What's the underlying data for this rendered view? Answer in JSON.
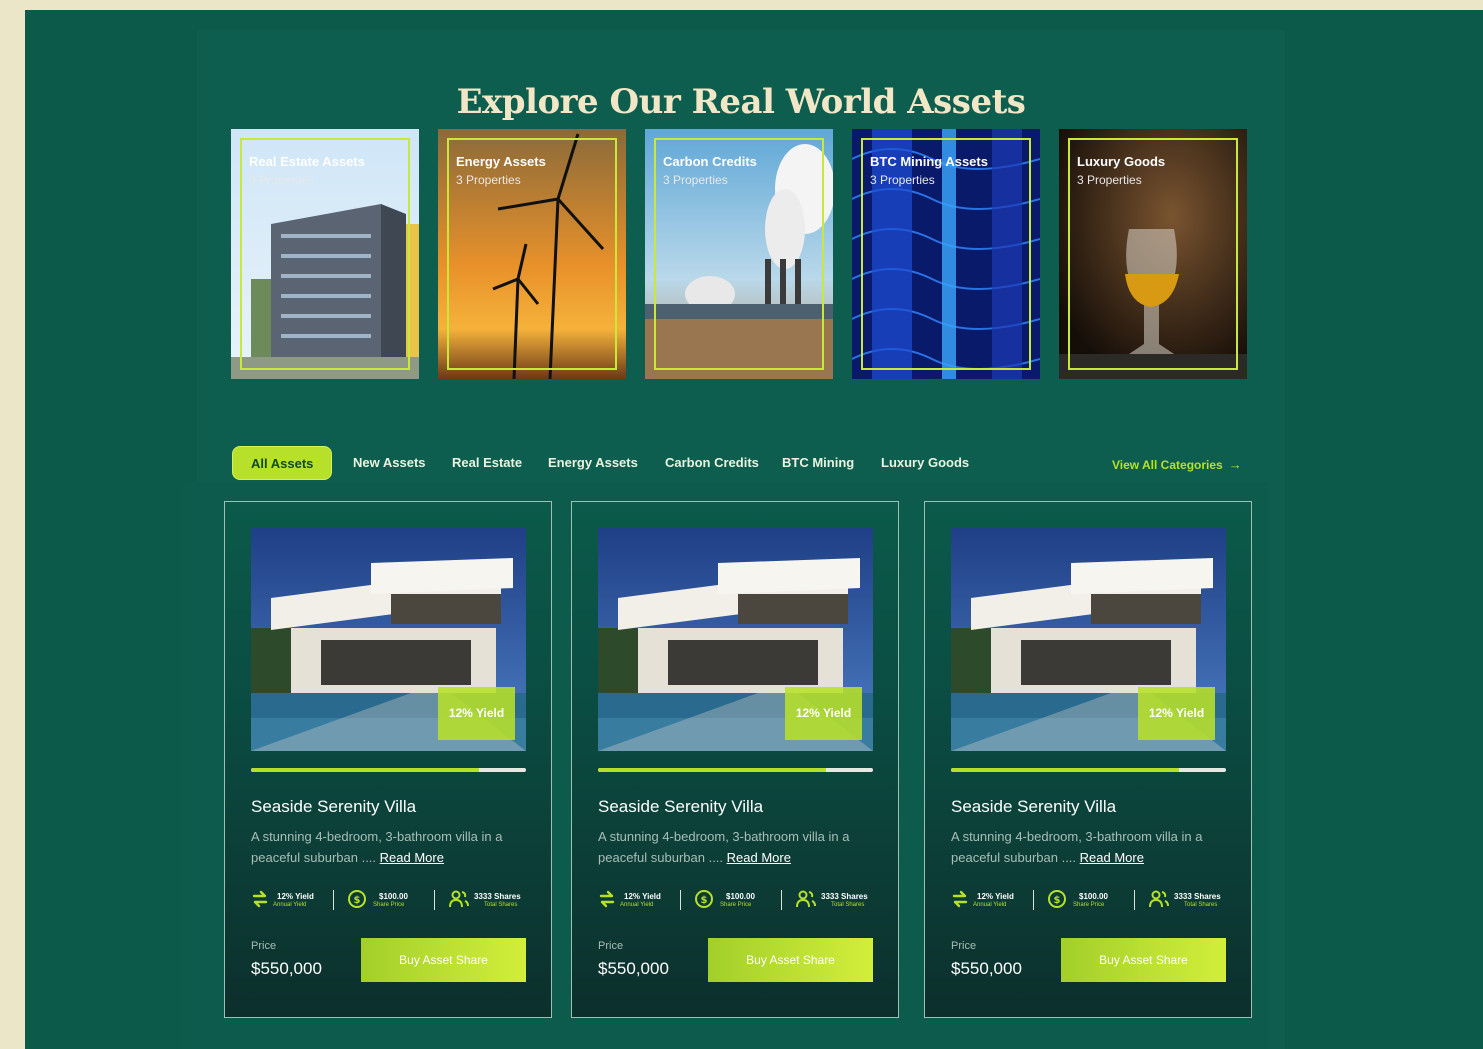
{
  "header": {
    "title": "Explore Our Real World Assets"
  },
  "categories": [
    {
      "name": "Real Estate Assets",
      "count": "3 Properties"
    },
    {
      "name": "Energy Assets",
      "count": "3 Properties"
    },
    {
      "name": "Carbon Credits",
      "count": "3 Properties"
    },
    {
      "name": "BTC Mining Assets",
      "count": "3 Properties"
    },
    {
      "name": "Luxury Goods",
      "count": "3 Properties"
    }
  ],
  "tabs": [
    "All Assets",
    "New Assets",
    "Real Estate",
    "Energy Assets",
    "Carbon Credits",
    "BTC Mining",
    "Luxury Goods"
  ],
  "active_tab": "All Assets",
  "view_all": {
    "label": "View All Categories",
    "icon": "arrow-right-icon"
  },
  "cards": [
    {
      "badge": "12% Yield",
      "progress": 0.83,
      "title": "Seaside Serenity Villa",
      "description": "A stunning 4-bedroom, 3-bathroom villa in a peaceful suburban ....",
      "read_more": "Read More",
      "stats": [
        {
          "icon": "swap-arrows-icon",
          "value": "12% Yield",
          "label": "Annual Yield"
        },
        {
          "icon": "dollar-coin-icon",
          "value": "$100.00",
          "label": "Share Price"
        },
        {
          "icon": "users-icon",
          "value": "3333 Shares",
          "label": "Total Shares"
        }
      ],
      "price_label": "Price",
      "price": "$550,000",
      "button": "Buy Asset Share"
    },
    {
      "badge": "12% Yield",
      "progress": 0.83,
      "title": "Seaside Serenity Villa",
      "description": "A stunning 4-bedroom, 3-bathroom villa in a peaceful suburban ....",
      "read_more": "Read More",
      "stats": [
        {
          "icon": "swap-arrows-icon",
          "value": "12% Yield",
          "label": "Annual Yield"
        },
        {
          "icon": "dollar-coin-icon",
          "value": "$100.00",
          "label": "Share Price"
        },
        {
          "icon": "users-icon",
          "value": "3333 Shares",
          "label": "Total Shares"
        }
      ],
      "price_label": "Price",
      "price": "$550,000",
      "button": "Buy Asset Share"
    },
    {
      "badge": "12% Yield",
      "progress": 0.83,
      "title": "Seaside Serenity Villa",
      "description": "A stunning 4-bedroom, 3-bathroom villa in a peaceful suburban ....",
      "read_more": "Read More",
      "stats": [
        {
          "icon": "swap-arrows-icon",
          "value": "12% Yield",
          "label": "Annual Yield"
        },
        {
          "icon": "dollar-coin-icon",
          "value": "$100.00",
          "label": "Share Price"
        },
        {
          "icon": "users-icon",
          "value": "3333 Shares",
          "label": "Total Shares"
        }
      ],
      "price_label": "Price",
      "price": "$550,000",
      "button": "Buy Asset Share"
    }
  ],
  "colors": {
    "accent": "#b7e02a",
    "background": "#0b5a4a",
    "title": "#f1e6c6"
  }
}
